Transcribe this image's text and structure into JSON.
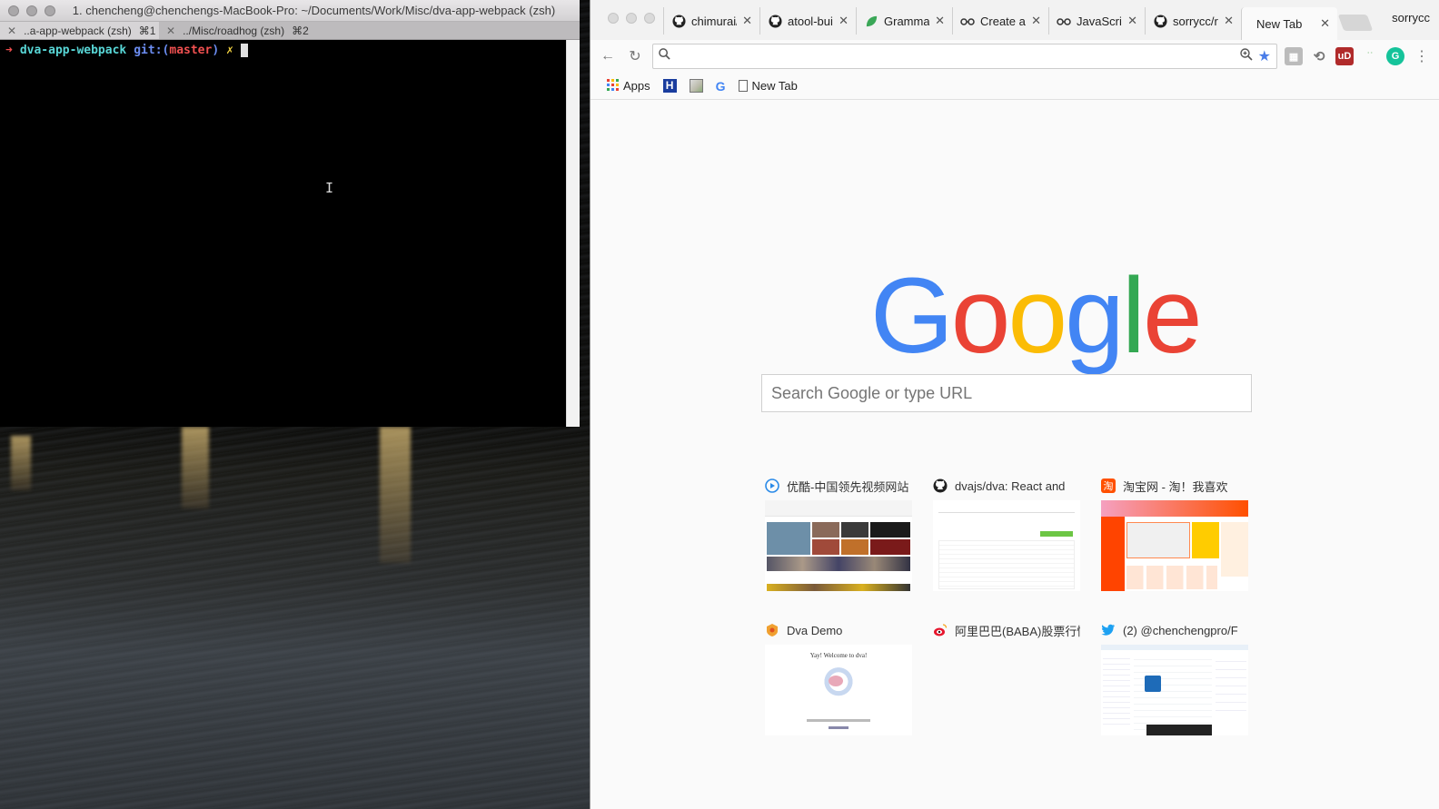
{
  "terminal": {
    "title": "1. chencheng@chenchengs-MacBook-Pro: ~/Documents/Work/Misc/dva-app-webpack (zsh)",
    "tabs": [
      {
        "label": "..a-app-webpack (zsh)",
        "shortcut": "⌘1"
      },
      {
        "label": "../Misc/roadhog (zsh)",
        "shortcut": "⌘2"
      }
    ],
    "prompt": {
      "arrow": "➜",
      "dir": "dva-app-webpack",
      "git_prefix": "git:(",
      "branch": "master",
      "git_suffix": ")",
      "dirty": "✗"
    }
  },
  "browser": {
    "tabs": [
      {
        "label": "chimurai/",
        "icon": "github-icon"
      },
      {
        "label": "atool-buil",
        "icon": "github-icon"
      },
      {
        "label": "Grammar",
        "icon": "leaf-icon"
      },
      {
        "label": "Create a",
        "icon": "glasses-icon"
      },
      {
        "label": "JavaScrip",
        "icon": "glasses-icon"
      },
      {
        "label": "sorrycc/r",
        "icon": "github-icon"
      },
      {
        "label": "New Tab",
        "icon": ""
      }
    ],
    "profile": "sorrycc",
    "omnibox": {
      "value": ""
    },
    "bookmarks": [
      {
        "label": "Apps",
        "icon": "apps-grid-icon"
      },
      {
        "label": "",
        "icon": "h-icon"
      },
      {
        "label": "",
        "icon": "image-icon"
      },
      {
        "label": "",
        "icon": "google-g-icon"
      },
      {
        "label": "New Tab",
        "icon": "page-icon"
      }
    ],
    "logo": [
      "G",
      "o",
      "o",
      "g",
      "l",
      "e"
    ],
    "logo_colors": [
      "#4285F4",
      "#EA4335",
      "#FBBC05",
      "#4285F4",
      "#34A853",
      "#EA4335"
    ],
    "search_placeholder": "Search Google or type URL",
    "most_visited": [
      {
        "title": "优酷-中国领先视频网站",
        "icon": "youku-icon"
      },
      {
        "title": "dvajs/dva: React and",
        "icon": "github-icon"
      },
      {
        "title": "淘宝网 - 淘！我喜欢",
        "icon": "taobao-icon"
      },
      {
        "title": "Dva Demo",
        "icon": "dva-icon",
        "thumb_text": "Yay! Welcome to dva!"
      },
      {
        "title": "阿里巴巴(BABA)股票行情",
        "icon": "weibo-icon"
      },
      {
        "title": "(2) @chenchengpro/F",
        "icon": "twitter-icon"
      }
    ]
  }
}
